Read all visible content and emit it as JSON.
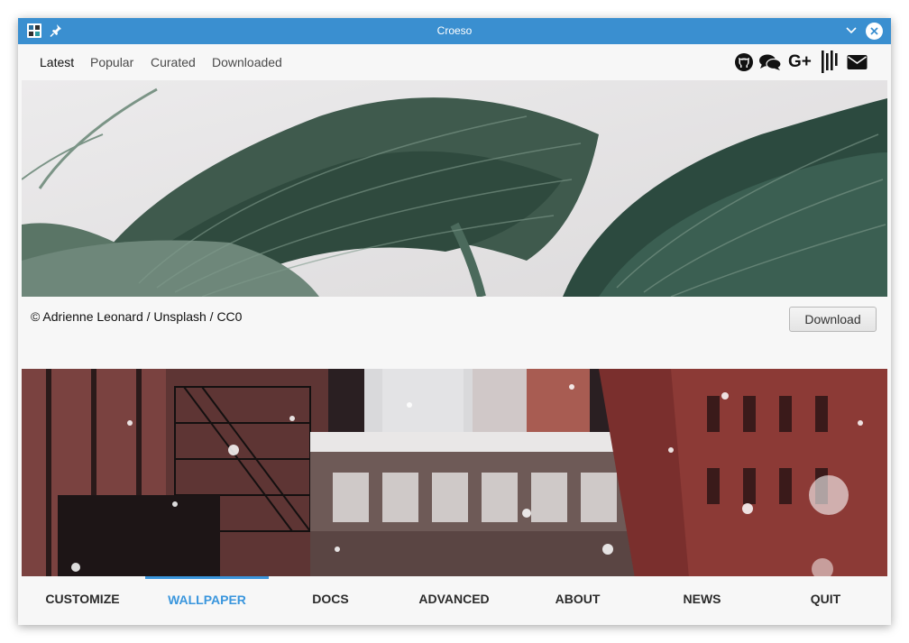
{
  "window": {
    "title": "Croeso",
    "accent": "#3a8fd0"
  },
  "top_tabs": [
    {
      "label": "Latest",
      "active": true
    },
    {
      "label": "Popular",
      "active": false
    },
    {
      "label": "Curated",
      "active": false
    },
    {
      "label": "Downloaded",
      "active": false
    }
  ],
  "social_icons": [
    "github-icon",
    "chat-icon",
    "google-plus-icon",
    "vk-icon",
    "mail-icon"
  ],
  "social": {
    "google_plus_label": "G+"
  },
  "wallpaper": {
    "credit": "© Adrienne Leonard / Unsplash / CC0",
    "download_label": "Download"
  },
  "bottom_nav": [
    {
      "label": "CUSTOMIZE",
      "active": false
    },
    {
      "label": "WALLPAPER",
      "active": true
    },
    {
      "label": "DOCS",
      "active": false
    },
    {
      "label": "ADVANCED",
      "active": false
    },
    {
      "label": "ABOUT",
      "active": false
    },
    {
      "label": "NEWS",
      "active": false
    },
    {
      "label": "QUIT",
      "active": false
    }
  ],
  "colors": {
    "active_nav": "#3a96dd",
    "background": "#f7f7f7"
  }
}
